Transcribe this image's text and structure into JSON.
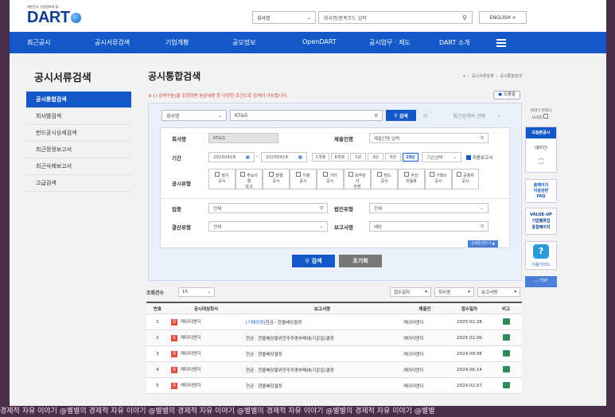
{
  "logo": {
    "subtitle": "대한민국 기업정보의 창",
    "name": "DART"
  },
  "top": {
    "select": "회사명",
    "search_placeholder": "회사명/종목코드 입력",
    "english": "ENGLISH >"
  },
  "nav": [
    "최근공시",
    "공시서류검색",
    "기업개황",
    "공모정보",
    "OpenDART",
    "공시업무 · 제도",
    "DART 소개"
  ],
  "sidebar": {
    "title": "공시서류검색",
    "items": [
      "공시통합검색",
      "회사별검색",
      "펀드공시상세검색",
      "최근정정보고서",
      "최근삭제보고서",
      "고급검색"
    ]
  },
  "main": {
    "title": "공시통합검색",
    "breadcrumb": [
      "공시서류검색",
      "공시통합검색"
    ],
    "notice": "※ [↓검색구분]을 조정하면 본문내용 등 다양한 조건으로 검색이 가능합니다.",
    "help": "도움말",
    "search_type": "회사명",
    "search_value": "KT&G",
    "search_btn": "검색",
    "recent": "최근검색어 선택",
    "labels": {
      "company": "회사명",
      "submitter": "제출인명",
      "period": "기간",
      "pub_type": "공시유형",
      "industry": "업종",
      "corp_type": "법인유형",
      "settle": "결산유형",
      "report": "보고서명"
    },
    "company_value": "KT&G",
    "submitter_placeholder": "제출인명 입력",
    "date_from": "20150418",
    "date_to": "20250418",
    "periods": [
      "1개월",
      "6개월",
      "1년",
      "3년",
      "5년",
      "10년"
    ],
    "period_select": "기간선택",
    "latest_report": "최종보고서",
    "pub_types": [
      [
        "정기",
        "공시"
      ],
      [
        "주요사",
        "항",
        "보고"
      ],
      [
        "발행",
        "공시"
      ],
      [
        "지분",
        "공시"
      ],
      [
        "기타",
        "공시"
      ],
      [
        "외부감",
        "사",
        "관련"
      ],
      [
        "펀드",
        "공시"
      ],
      [
        "자산",
        "유동화"
      ],
      [
        "거래소",
        "공시"
      ],
      [
        "공정위",
        "공시"
      ]
    ],
    "industry_value": "전체",
    "corp_type_value": "전체",
    "settle_value": "전체",
    "report_value": "배당",
    "detail_toggle": "상세조건닫기 ▲",
    "search_button": "검색",
    "reset_button": "초기화"
  },
  "list": {
    "count_label": "조회건수",
    "count_value": "15",
    "sort1": "접수일자",
    "sort2": "회사명",
    "sort3": "보고서명",
    "columns": [
      "번호",
      "공시대상회사",
      "보고서명",
      "제출인",
      "접수일자",
      "비고"
    ],
    "rows": [
      {
        "no": "1",
        "corp": "케이티앤지",
        "tag": "[기재정정]",
        "report": "현금 · 현물배당결정",
        "submitter": "케이티앤지",
        "date": "2025.02.28"
      },
      {
        "no": "2",
        "corp": "케이티앤지",
        "tag": "",
        "report": "현금 · 현물배당을위한주주명부폐쇄(기준일)결정",
        "submitter": "케이티앤지",
        "date": "2025.02.06"
      },
      {
        "no": "3",
        "corp": "케이티앤지",
        "tag": "",
        "report": "현금 · 현물배당결정",
        "submitter": "케이티앤지",
        "date": "2024.08.08"
      },
      {
        "no": "4",
        "corp": "케이티앤지",
        "tag": "",
        "report": "현금 · 현물배당을위한주주명부폐쇄(기준일)결정",
        "submitter": "케이티앤지",
        "date": "2024.06.14"
      },
      {
        "no": "5",
        "corp": "케이티앤지",
        "tag": "",
        "report": "현금 · 현물배당결정",
        "submitter": "케이티앤지",
        "date": "2024.02.07"
      }
    ]
  },
  "right": {
    "collapse_label": "최대기 변경시",
    "collapse_label2": "UI과정",
    "today_title": "오늘본공시",
    "today_count": "(총0건)",
    "faq": [
      "홈페이지",
      "이용관련",
      "FAQ"
    ],
    "valueup": [
      "VALUE-UP",
      "기업밸류업",
      "통합페이지"
    ],
    "guide": "이용가이드",
    "top": "TOP"
  },
  "watermark": "경제적 자유 이야기  @별별의 경제적 자유 이야기      @별별의 경제적 자유 이야기 @별별의 경제적 자유 이야기        @별별의 경제적 자유 이야기    @별별"
}
